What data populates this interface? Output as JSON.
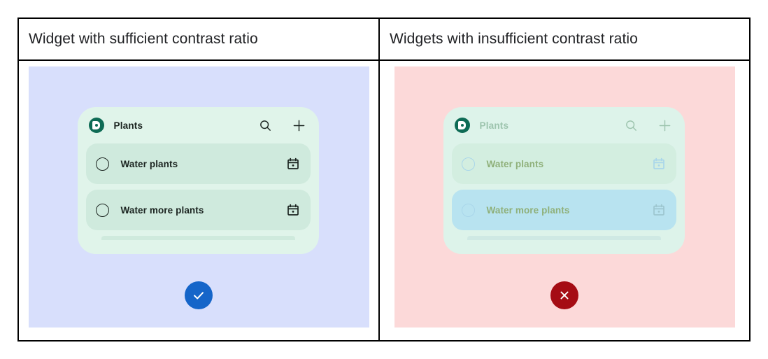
{
  "table": {
    "columns": [
      {
        "id": "sufficient",
        "header": "Widget with sufficient contrast ratio",
        "panel_bg": "#d8dffc",
        "verdict_icon": "check-icon",
        "verdict_color": "#1565c9"
      },
      {
        "id": "insufficient",
        "header": "Widgets with insufficient contrast ratio",
        "panel_bg": "#fcd9d9",
        "verdict_icon": "close-icon",
        "verdict_color": "#a50c14"
      }
    ]
  },
  "widget": {
    "app_icon_name": "tasks-app-icon",
    "title": "Plants",
    "actions": [
      {
        "name": "search-icon",
        "label": "Search"
      },
      {
        "name": "add-icon",
        "label": "Add task"
      }
    ],
    "tasks": [
      {
        "label": "Water plants",
        "checkbox": "radio-unchecked-icon",
        "trailing": "calendar-icon"
      },
      {
        "label": "Water more plants",
        "checkbox": "radio-unchecked-icon",
        "trailing": "calendar-icon"
      }
    ]
  },
  "colors": {
    "panel_good": "#d8dffc",
    "panel_bad": "#fcd9d9",
    "widget_bg_good": "#e0f4ea",
    "widget_bg_bad": "#ddf3ea",
    "row_good": "#cfeadd",
    "row_bad_1": "#d3eee0",
    "row_bad_2": "#b8e3f0",
    "text_good": "#1b2420",
    "text_bad": "#8fb07a",
    "app_icon": "#0e6b55",
    "pass_badge": "#1565c9",
    "fail_badge": "#a50c14",
    "border": "#000000"
  }
}
